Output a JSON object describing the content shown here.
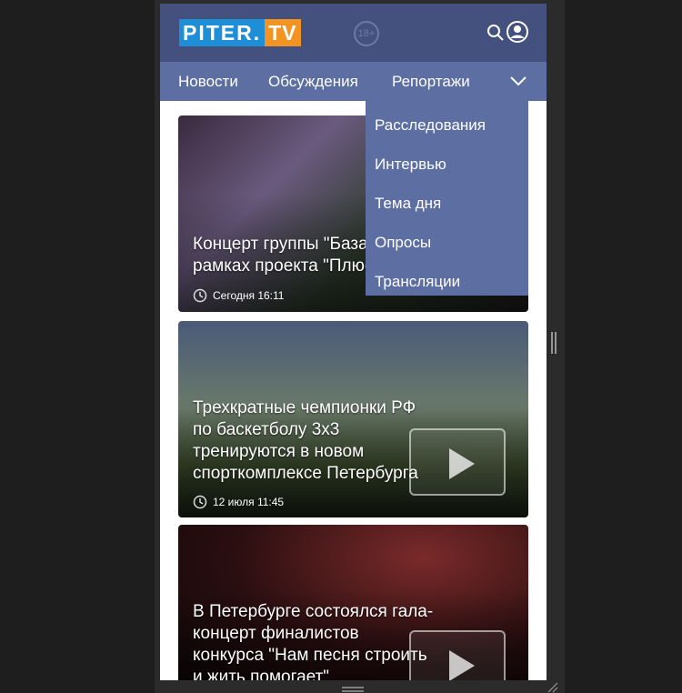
{
  "header": {
    "logo_piter": "PITER.",
    "logo_tv": "TV",
    "age_badge": "18+",
    "search_icon": "search-icon",
    "user_icon": "user-icon"
  },
  "nav": {
    "items": [
      "Новости",
      "Обсуждения",
      "Репортажи"
    ],
    "more_icon": "chevron-down-icon"
  },
  "dropdown": {
    "items": [
      "Расследования",
      "Интервью",
      "Тема дня",
      "Опросы",
      "Трансляции"
    ]
  },
  "cards": [
    {
      "title_lines": [
        "Концерт группы \"Базар",
        "рамках проекта \"Плюс"
      ],
      "time": "Сегодня 16:11",
      "has_play": false
    },
    {
      "title_lines": [
        "Трехкратные чемпионки РФ",
        "по баскетболу 3х3",
        "тренируются в новом",
        "спорткомплексе Петербурга"
      ],
      "time": "12 июля 11:45",
      "has_play": true
    },
    {
      "title_lines": [
        "В Петербурге состоялся гала-",
        "концерт финалистов",
        "конкурса \"Нам песня строить",
        "и жить помогает\""
      ],
      "has_play": true
    }
  ],
  "colors": {
    "header_bg": "#44507d",
    "nav_bg": "#5d6ea3",
    "logo_blue": "#1e8fd6",
    "logo_orange": "#f39322"
  }
}
